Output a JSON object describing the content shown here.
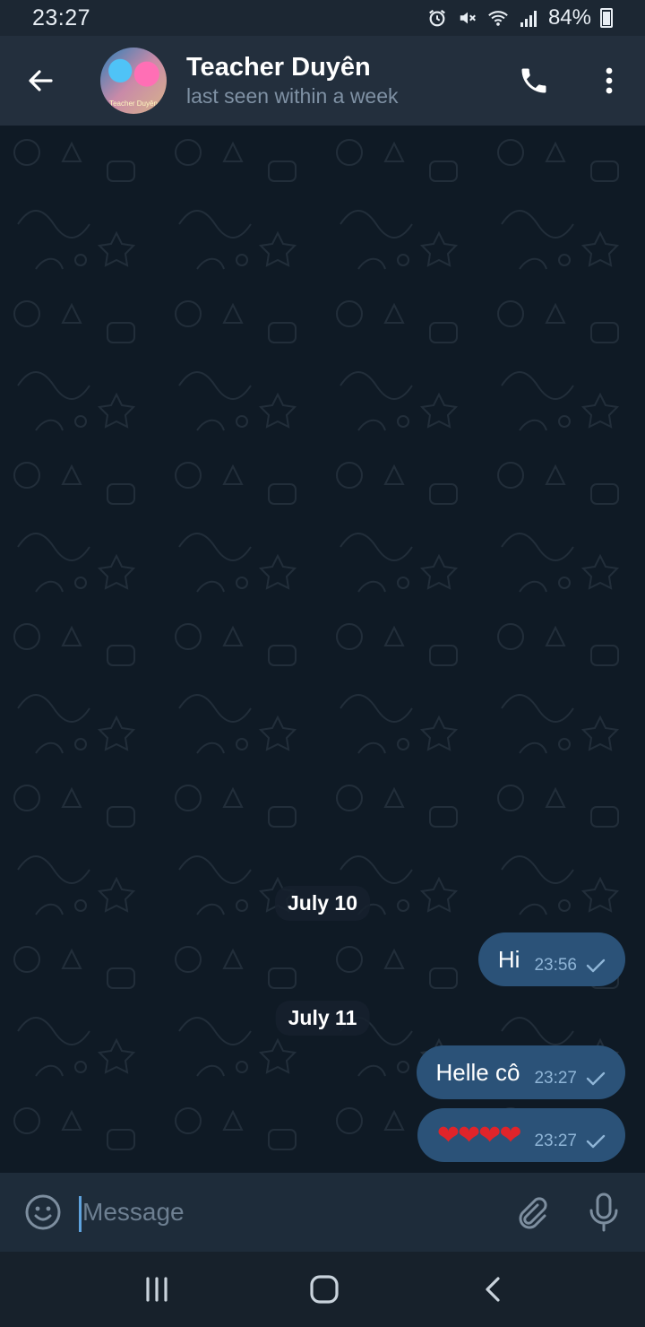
{
  "status_bar": {
    "time": "23:27",
    "battery": "84%",
    "icons": [
      "alarm-icon",
      "mute-icon",
      "wifi-icon",
      "signal-icon",
      "battery-icon"
    ]
  },
  "header": {
    "title": "Teacher Duyên",
    "subtitle": "last seen within a week",
    "avatar_caption": "Teacher Duyên"
  },
  "messages": [
    {
      "type": "date",
      "text": "July 10"
    },
    {
      "type": "outgoing",
      "text": "Hi",
      "time": "23:56",
      "status": "sent"
    },
    {
      "type": "date",
      "text": "July 11"
    },
    {
      "type": "outgoing",
      "text": "Helle cô",
      "time": "23:27",
      "status": "sent"
    },
    {
      "type": "outgoing",
      "text": "❤❤❤❤",
      "time": "23:27",
      "status": "sent"
    }
  ],
  "composer": {
    "placeholder": "Message"
  },
  "colors": {
    "header_bg": "#232f3d",
    "chat_bg": "#0f1a25",
    "bubble_out": "#2b5278",
    "accent": "#5fa3de",
    "subtitle": "#7f91a4"
  }
}
